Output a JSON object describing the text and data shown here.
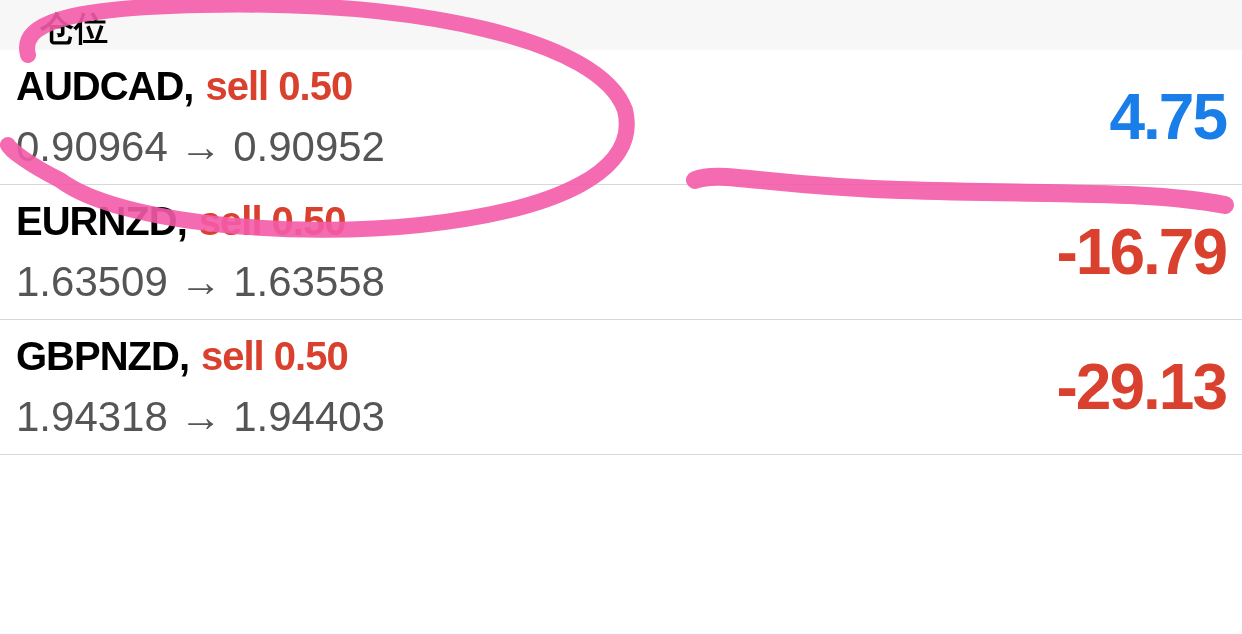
{
  "header": {
    "title": "仓位"
  },
  "positions": [
    {
      "symbol": "AUDCAD,",
      "order": "sell 0.50",
      "prices": "0.90964 → 0.90952",
      "profit": "4.75",
      "color": "#1a7ee8"
    },
    {
      "symbol": "EURNZD,",
      "order": "sell 0.50",
      "prices": "1.63509 → 1.63558",
      "profit": "-16.79",
      "color": "#d9412e"
    },
    {
      "symbol": "GBPNZD,",
      "order": "sell 0.50",
      "prices": "1.94318 → 1.94403",
      "profit": "-29.13",
      "color": "#d9412e"
    }
  ]
}
